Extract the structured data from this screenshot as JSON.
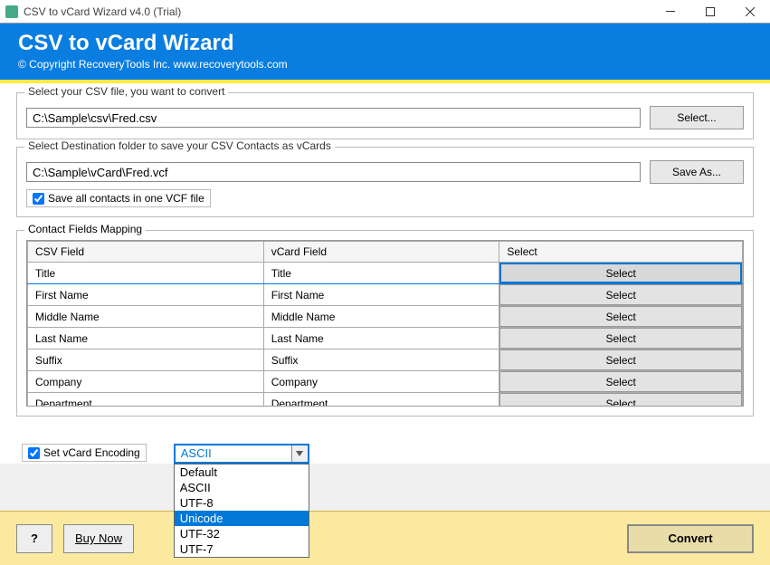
{
  "window": {
    "title": "CSV to vCard Wizard v4.0 (Trial)"
  },
  "header": {
    "title": "CSV to vCard Wizard",
    "copyright": "© Copyright RecoveryTools Inc. www.recoverytools.com"
  },
  "csv_section": {
    "legend": "Select your CSV file, you want to convert",
    "path": "C:\\Sample\\csv\\Fred.csv",
    "button": "Select..."
  },
  "dest_section": {
    "legend": "Select Destination folder to save your CSV Contacts as vCards",
    "path": "C:\\Sample\\vCard\\Fred.vcf",
    "button": "Save As...",
    "checkbox_label": "Save all contacts in one VCF file"
  },
  "mapping": {
    "legend": "Contact Fields Mapping",
    "headers": {
      "csv": "CSV Field",
      "vcard": "vCard Field",
      "select": "Select"
    },
    "select_label": "Select",
    "rows": [
      {
        "csv": "Title",
        "vcard": "Title"
      },
      {
        "csv": "First Name",
        "vcard": "First Name"
      },
      {
        "csv": "Middle Name",
        "vcard": "Middle Name"
      },
      {
        "csv": "Last Name",
        "vcard": "Last Name"
      },
      {
        "csv": "Suffix",
        "vcard": "Suffix"
      },
      {
        "csv": "Company",
        "vcard": "Company"
      },
      {
        "csv": "Department",
        "vcard": "Department"
      }
    ]
  },
  "encoding": {
    "checkbox_label": "Set vCard Encoding",
    "value": "ASCII",
    "options": [
      "Default",
      "ASCII",
      "UTF-8",
      "Unicode",
      "UTF-32",
      "UTF-7"
    ],
    "selected_index": 3
  },
  "footer": {
    "help": "?",
    "buy": "Buy Now",
    "convert": "Convert"
  }
}
